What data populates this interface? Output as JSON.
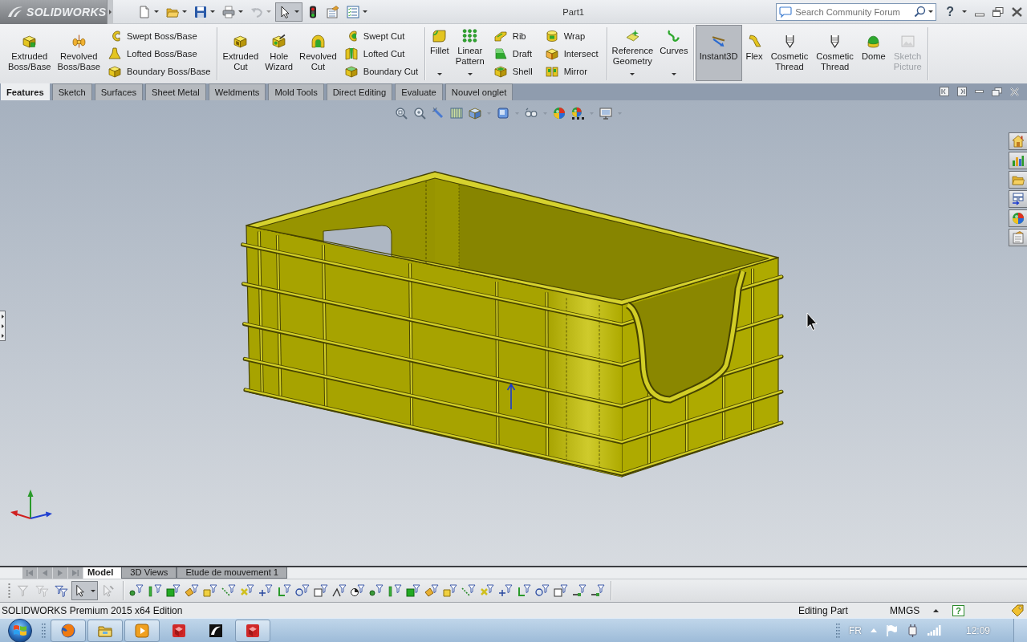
{
  "title_bar": {
    "logo": "SOLIDWORKS",
    "title": "Part1",
    "search_placeholder": "Search Community Forum",
    "help": "?"
  },
  "quick_access": [
    {
      "dropdown": true,
      "on": false,
      "disabled": false
    },
    {
      "dropdown": true,
      "on": false,
      "disabled": false
    },
    {
      "dropdown": true,
      "on": false,
      "disabled": false
    },
    {
      "dropdown": true,
      "on": false,
      "disabled": false
    },
    {
      "dropdown": true,
      "on": false,
      "disabled": true
    },
    {
      "dropdown": true,
      "on": true,
      "disabled": false
    },
    {
      "dropdown": false,
      "on": false,
      "disabled": false
    },
    {
      "dropdown": false,
      "on": false,
      "disabled": false
    },
    {
      "dropdown": true,
      "on": false,
      "disabled": false
    }
  ],
  "ribbon": [
    {
      "buttons": [
        {
          "label": "Extruded Boss/Base"
        },
        {
          "label": "Revolved Boss/Base"
        }
      ],
      "stacks": [
        [
          "Swept Boss/Base",
          "Lofted Boss/Base",
          "Boundary Boss/Base"
        ]
      ]
    },
    {
      "buttons": [
        {
          "label": "Extruded Cut"
        },
        {
          "label": "Hole Wizard"
        },
        {
          "label": "Revolved Cut"
        }
      ],
      "stacks": [
        [
          "Swept Cut",
          "Lofted Cut",
          "Boundary Cut"
        ]
      ]
    },
    {
      "buttons": [
        {
          "label": "Fillet",
          "dropdown": true
        },
        {
          "label": "Linear Pattern",
          "dropdown": true
        }
      ],
      "stacks": [
        [
          "Rib",
          "Draft",
          "Shell"
        ],
        [
          "Wrap",
          "Intersect",
          "Mirror"
        ]
      ]
    },
    {
      "buttons": [
        {
          "label": "Reference Geometry",
          "dropdown": true
        },
        {
          "label": "Curves",
          "dropdown": true
        }
      ]
    },
    {
      "buttons": [
        {
          "label": "Instant3D",
          "on": true,
          "disabled": false
        },
        {
          "label": "Flex",
          "on": false,
          "disabled": false
        },
        {
          "label": "Cosmetic Thread",
          "on": false,
          "disabled": false
        },
        {
          "label": "Cosmetic Thread",
          "on": false,
          "disabled": false
        },
        {
          "label": "Dome",
          "on": false,
          "disabled": false
        },
        {
          "label": "Sketch Picture",
          "on": false,
          "disabled": true
        }
      ]
    }
  ],
  "feature_tabs": [
    {
      "label": "Features",
      "selected": true
    },
    {
      "label": "Sketch",
      "selected": false
    },
    {
      "label": "Surfaces",
      "selected": false
    },
    {
      "label": "Sheet Metal",
      "selected": false
    },
    {
      "label": "Weldments",
      "selected": false
    },
    {
      "label": "Mold Tools",
      "selected": false
    },
    {
      "label": "Direct Editing",
      "selected": false
    },
    {
      "label": "Evaluate",
      "selected": false
    },
    {
      "label": "Nouvel onglet",
      "selected": false
    }
  ],
  "model_tabs": [
    {
      "label": "Model",
      "selected": true
    },
    {
      "label": "3D Views",
      "selected": false
    },
    {
      "label": "Etude de mouvement 1",
      "selected": false
    }
  ],
  "filter_toolbar": [
    {
      "on": false,
      "disabled": true
    },
    {
      "on": false,
      "disabled": true
    },
    {
      "on": false,
      "disabled": false
    },
    {
      "on": true,
      "disabled": false
    },
    {
      "on": false,
      "disabled": true
    }
  ],
  "status_bar": {
    "edition": "SOLIDWORKS Premium 2015 x64 Edition",
    "mode": "Editing Part",
    "units": "MMGS",
    "help": "?"
  },
  "taskbar": {
    "apps": [
      {
        "running": true
      },
      {
        "running": true
      },
      {
        "running": true
      },
      {
        "running": false
      },
      {
        "running": false
      },
      {
        "running": true
      }
    ],
    "language": "FR",
    "clock": "12:09"
  }
}
